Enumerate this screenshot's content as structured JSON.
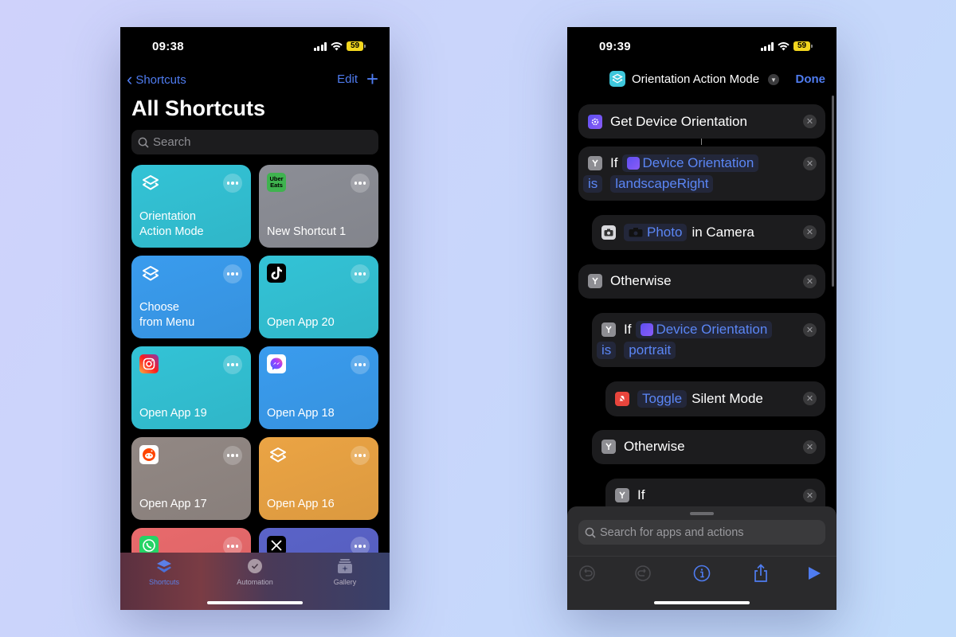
{
  "left_phone": {
    "status": {
      "time": "09:38",
      "battery": "59"
    },
    "nav": {
      "back_label": "Shortcuts",
      "edit_label": "Edit",
      "add_label": "+"
    },
    "title": "All Shortcuts",
    "search": {
      "placeholder": "Search"
    },
    "shortcuts": [
      {
        "title": "Orientation\nAction Mode",
        "icon": "layers-icon",
        "color": "#33c3d6"
      },
      {
        "title": "New Shortcut 1",
        "icon": "uber-eats-icon",
        "icon_text": "Uber Eats",
        "color": "#8c8e96"
      },
      {
        "title": "Choose\nfrom Menu",
        "icon": "layers-icon",
        "color": "#3a9cee"
      },
      {
        "title": "Open App 20",
        "icon": "tiktok-icon",
        "color": "#33c3d6"
      },
      {
        "title": "Open App 19",
        "icon": "instagram-icon",
        "color": "#33c3d6"
      },
      {
        "title": "Open App 18",
        "icon": "messenger-icon",
        "color": "#3a9cee"
      },
      {
        "title": "Open App 17",
        "icon": "reddit-icon",
        "color": "#928884"
      },
      {
        "title": "Open App 16",
        "icon": "layers-icon",
        "color": "#eba444"
      },
      {
        "title": "",
        "icon": "whatsapp-icon",
        "color": "#e86a6c"
      },
      {
        "title": "",
        "icon": "x-icon",
        "color": "#5a63c8"
      }
    ],
    "tabs": [
      {
        "label": "Shortcuts",
        "icon": "shortcuts-icon",
        "active": true
      },
      {
        "label": "Automation",
        "icon": "automation-icon",
        "active": false
      },
      {
        "label": "Gallery",
        "icon": "gallery-icon",
        "active": false
      }
    ]
  },
  "right_phone": {
    "status": {
      "time": "09:39",
      "battery": "59"
    },
    "header": {
      "title": "Orientation Action Mode",
      "done_label": "Done"
    },
    "actions": [
      {
        "type": "get",
        "label": "Get Device Orientation"
      },
      {
        "type": "if",
        "keyword": "If",
        "variable": "Device Orientation",
        "operator": "is",
        "value": "landscapeRight"
      },
      {
        "type": "action",
        "token": "Photo",
        "suffix": "in Camera"
      },
      {
        "type": "otherwise",
        "label": "Otherwise"
      },
      {
        "type": "if",
        "keyword": "If",
        "variable": "Device Orientation",
        "operator": "is",
        "value": "portrait"
      },
      {
        "type": "action",
        "token": "Toggle",
        "suffix": "Silent Mode"
      },
      {
        "type": "otherwise",
        "label": "Otherwise"
      },
      {
        "type": "if",
        "keyword": "If"
      }
    ],
    "sheet": {
      "search_placeholder": "Search for apps and actions"
    },
    "accent": "#4f7cf0"
  }
}
